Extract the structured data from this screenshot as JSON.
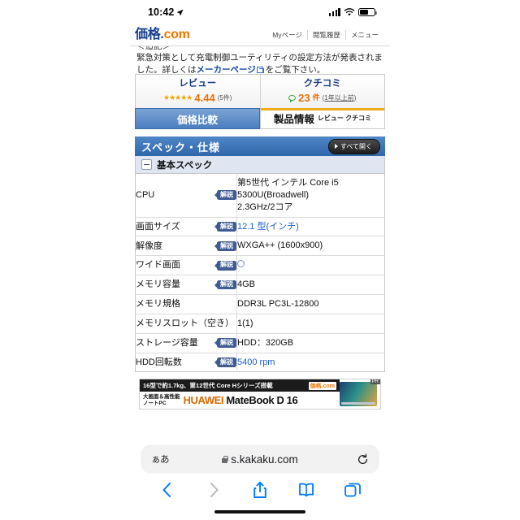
{
  "status_bar": {
    "time": "10:42",
    "location_icon": "location-arrow-icon",
    "signal_icon": "cellular-bars-icon",
    "wifi_icon": "wifi-icon",
    "battery_icon": "battery-icon"
  },
  "site_header": {
    "logo_main": "価格",
    "logo_dot": ".",
    "logo_com": "com",
    "nav": [
      "Myページ",
      "閲覧履歴",
      "メニュー"
    ]
  },
  "notice": {
    "line0": "＜追記＞",
    "line1": "緊急対策として充電制御ユーティリティの設定方法が発表されま",
    "line2_pre": "した。詳しくは",
    "link": "メーカーページ",
    "line2_post": " をご覧下さい。"
  },
  "summary": {
    "review": {
      "title": "レビュー",
      "stars": "★★★★★",
      "score": "4.44",
      "count": "(5件)"
    },
    "kuchikomi": {
      "title": "クチコミ",
      "count": "23",
      "unit": "件",
      "age": "(1年以上前)"
    }
  },
  "tabs": [
    {
      "label": "価格比較",
      "sub": "",
      "active": false
    },
    {
      "label": "製品情報",
      "sub": "レビュー クチコミ",
      "active": true
    }
  ],
  "spec_section": {
    "title": "スペック・仕様",
    "open_all": "すべて開く",
    "group_title": "基本スペック",
    "badge": "解説",
    "rows": [
      {
        "label": "CPU",
        "badge": true,
        "value": "第5世代 インテル Core i5 5300U(Broadwell)\n2.3GHz/2コア",
        "link": false
      },
      {
        "label": "画面サイズ",
        "badge": true,
        "value": "12.1 型(インチ)",
        "link": true
      },
      {
        "label": "解像度",
        "badge": true,
        "value": "WXGA++ (1600x900)",
        "link": false
      },
      {
        "label": "ワイド画面",
        "badge": true,
        "value": "○",
        "link": false,
        "circle": true
      },
      {
        "label": "メモリ容量",
        "badge": true,
        "value": "4GB",
        "link": false
      },
      {
        "label": "メモリ規格",
        "badge": false,
        "value": "DDR3L PC3L-12800",
        "link": false
      },
      {
        "label": "メモリスロット（空き）",
        "badge": false,
        "value": "1(1)",
        "link": false
      },
      {
        "label": "ストレージ容量",
        "badge": true,
        "value": "HDD：320GB",
        "link": false
      },
      {
        "label": "HDD回転数",
        "badge": true,
        "value": "5400 rpm",
        "link": true
      }
    ]
  },
  "ad": {
    "headline": "16型で約1.7kg、第12世代 Core Hシリーズ搭載",
    "logo": "価格.com",
    "category": "大画面＆高性能\nノートPC",
    "brand_1": "HUAWEI",
    "brand_2": "MateBook D 16",
    "pr_tag": "PR"
  },
  "browser": {
    "text_size_button": "ぁあ",
    "lock_icon": "lock-icon",
    "url": "s.kakaku.com",
    "reload_icon": "reload-icon",
    "toolbar": [
      "back-icon",
      "forward-icon",
      "share-icon",
      "bookmarks-icon",
      "tabs-icon"
    ]
  },
  "colors": {
    "brand_blue": "#123c8e",
    "brand_orange": "#f07800",
    "link_blue": "#1c5fd0",
    "accent_gold": "#f0ab1d",
    "spec_header": "#2f67ab",
    "safari_blue": "#007aff"
  }
}
